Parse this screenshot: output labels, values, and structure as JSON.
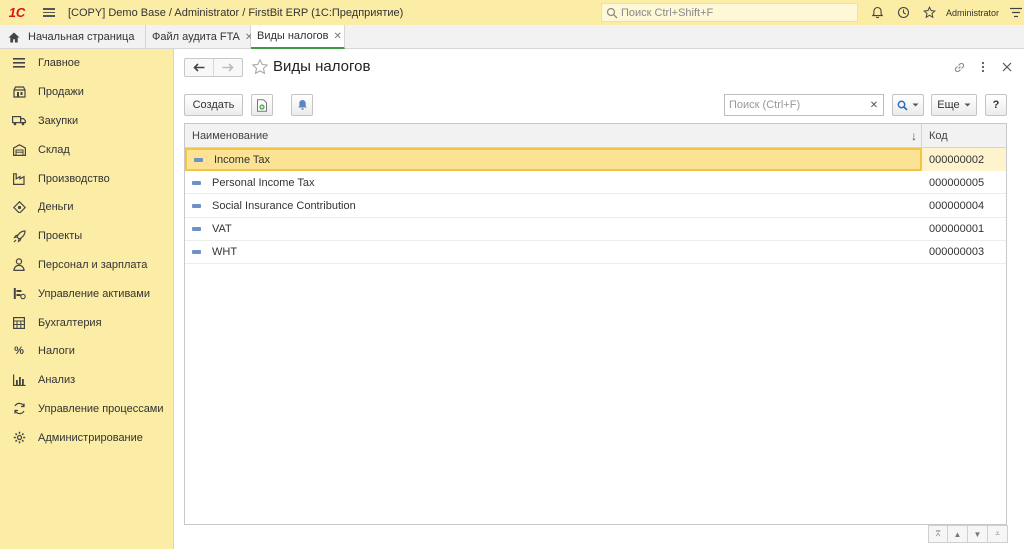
{
  "app": {
    "logo": "1C",
    "title": "[COPY] Demo Base / Administrator / FirstBit ERP  (1С:Предприятие)",
    "search_placeholder": "Поиск Ctrl+Shift+F",
    "user": "Administrator"
  },
  "tabs": [
    {
      "label": "Начальная страница"
    },
    {
      "label": "Файл аудита FTA"
    },
    {
      "label": "Виды налогов"
    }
  ],
  "sidebar": {
    "items": [
      {
        "label": "Главное",
        "icon": "menu-lines-icon"
      },
      {
        "label": "Продажи",
        "icon": "shop-icon"
      },
      {
        "label": "Закупки",
        "icon": "truck-icon"
      },
      {
        "label": "Склад",
        "icon": "warehouse-icon"
      },
      {
        "label": "Производство",
        "icon": "factory-icon"
      },
      {
        "label": "Деньги",
        "icon": "money-icon"
      },
      {
        "label": "Проекты",
        "icon": "rocket-icon"
      },
      {
        "label": "Персонал и зарплата",
        "icon": "person-icon"
      },
      {
        "label": "Управление активами",
        "icon": "assets-icon"
      },
      {
        "label": "Бухгалтерия",
        "icon": "ledger-icon"
      },
      {
        "label": "Налоги",
        "icon": "percent-icon"
      },
      {
        "label": "Анализ",
        "icon": "chart-icon"
      },
      {
        "label": "Управление процессами",
        "icon": "process-icon"
      },
      {
        "label": "Администрирование",
        "icon": "gear-icon"
      }
    ]
  },
  "page": {
    "title": "Виды налогов",
    "create_label": "Создать",
    "search_placeholder": "Поиск (Ctrl+F)",
    "more_label": "Еще",
    "help_label": "?"
  },
  "table": {
    "columns": {
      "name": "Наименование",
      "code": "Код"
    },
    "rows": [
      {
        "name": "Income Tax",
        "code": "000000002"
      },
      {
        "name": "Personal Income Tax",
        "code": "000000005"
      },
      {
        "name": "Social Insurance Contribution",
        "code": "000000004"
      },
      {
        "name": "VAT",
        "code": "000000001"
      },
      {
        "name": "WHT",
        "code": "000000003"
      }
    ]
  }
}
